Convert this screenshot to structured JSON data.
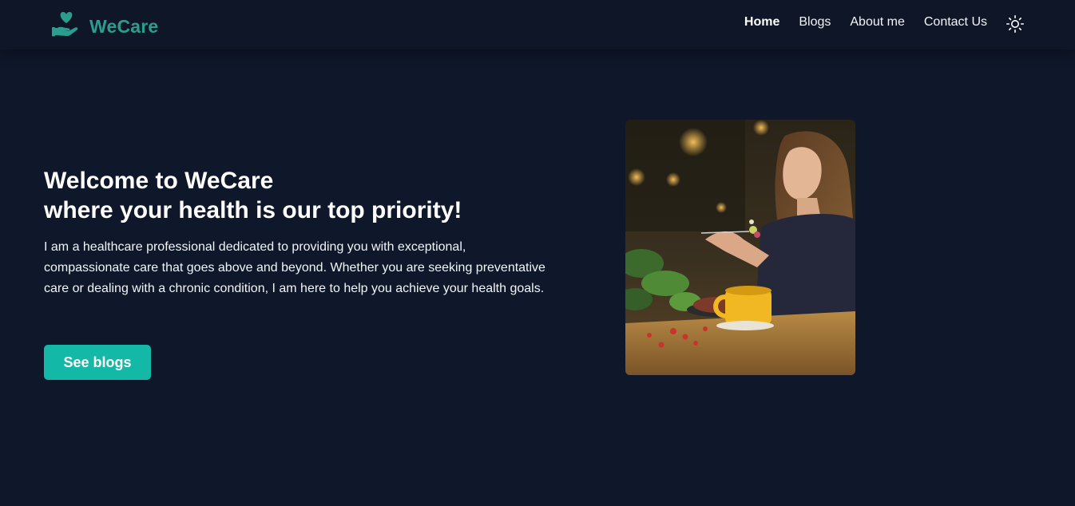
{
  "brand": {
    "name": "WeCare",
    "color": "#2a9d8f",
    "icon": "heart-in-hand-icon"
  },
  "nav": {
    "links": [
      {
        "label": "Home",
        "active": true
      },
      {
        "label": "Blogs",
        "active": false
      },
      {
        "label": "About me",
        "active": false
      },
      {
        "label": "Contact Us",
        "active": false
      }
    ],
    "theme_toggle_icon": "sun-icon"
  },
  "hero": {
    "title_line1": "Welcome to WeCare",
    "title_line2": "where your health is our top priority!",
    "description": "I am a  healthcare  professional  dedicated  to providing you with exceptional, compassionate care that goes above and beyond. Whether you are seeking preventative care or dealing with a chronic condition, I am here to help you achieve your health goals.",
    "cta_label": "See blogs",
    "cta_color": "#14b8a6",
    "image_icon": "woman-eating-salad-photo"
  },
  "colors": {
    "background": "#0f172a",
    "navbar": "#0f1628",
    "text": "#ffffff"
  }
}
